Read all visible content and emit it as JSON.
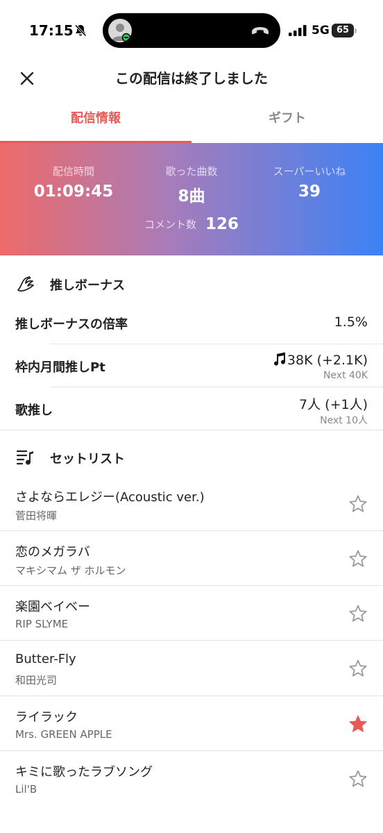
{
  "status_bar": {
    "time": "17:15",
    "network": "5G",
    "battery": "65"
  },
  "header": {
    "title": "この配信は終了しました"
  },
  "tabs": [
    {
      "label": "配信情報",
      "active": true
    },
    {
      "label": "ギフト",
      "active": false
    }
  ],
  "stats": {
    "duration_label": "配信時間",
    "duration_value": "01:09:45",
    "songs_label": "歌った曲数",
    "songs_value": "8曲",
    "likes_label": "スーパーいいね",
    "likes_value": "39",
    "comments_label": "コメント数",
    "comments_value": "126"
  },
  "oshi_bonus": {
    "title": "推しボーナス",
    "rate_label": "推しボーナスの倍率",
    "rate_value": "1.5%",
    "monthly_label": "枠内月間推しPt",
    "monthly_value": "38K (+2.1K)",
    "monthly_next": "Next 40K",
    "song_oshi_label": "歌推し",
    "song_oshi_value": "7人 (+1人)",
    "song_oshi_next": "Next 10人"
  },
  "setlist": {
    "title": "セットリスト",
    "songs": [
      {
        "title": "さよならエレジー(Acoustic ver.)",
        "artist": "菅田将暉",
        "starred": false
      },
      {
        "title": "恋のメガラバ",
        "artist": "マキシマム ザ ホルモン",
        "starred": false
      },
      {
        "title": "楽園ベイベー",
        "artist": "RIP SLYME",
        "starred": false
      },
      {
        "title": "Butter-Fly",
        "artist": "和田光司",
        "starred": false
      },
      {
        "title": "ライラック",
        "artist": "Mrs. GREEN APPLE",
        "starred": true
      },
      {
        "title": "キミに歌ったラブソング",
        "artist": "Lil'B",
        "starred": false
      }
    ]
  },
  "colors": {
    "accent": "#e85a55",
    "star_active": "#e85a55",
    "star_inactive": "#9a9a9a"
  }
}
